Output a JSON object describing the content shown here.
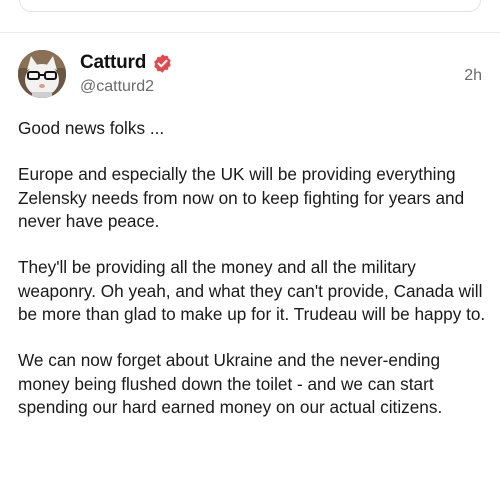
{
  "post": {
    "author_name": "Catturd",
    "handle": "@catturd2",
    "time": "2h",
    "verified_icon": "verified-badge-icon",
    "colors": {
      "verified_badge": "#e8474b",
      "handle_text": "#6b6b6b"
    },
    "paragraphs": [
      "Good news folks ...",
      "Europe and especially the UK will be providing everything Zelensky needs from now on to keep fighting for years and never have peace.",
      "They'll be providing all the money and all the military weaponry. Oh yeah, and what they can't provide, Canada will be more than glad to make up for it. Trudeau will be happy to.",
      "We can now forget about Ukraine and the never-ending money being flushed down the toilet - and we can start spending our hard earned money on our actual citizens."
    ]
  }
}
